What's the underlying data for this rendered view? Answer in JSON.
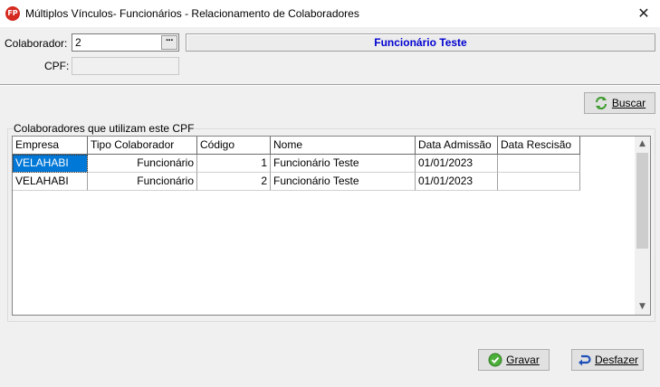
{
  "window": {
    "app_icon_text": "FP",
    "title": "Múltiplos Vínculos- Funcionários - Relacionamento de Colaboradores",
    "close_glyph": "✕"
  },
  "form": {
    "colaborador_label": "Colaborador:",
    "colaborador_value": "2",
    "lookup_button_label": "···",
    "colaborador_name": "Funcionário Teste",
    "cpf_label": "CPF:",
    "cpf_value": ""
  },
  "buscar": {
    "label": "Buscar",
    "icon": "refresh-icon"
  },
  "group": {
    "title": "Colaboradores que utilizam este CPF",
    "columns": [
      "Empresa",
      "Tipo Colaborador",
      "Código",
      "Nome",
      "Data Admissão",
      "Data Rescisão"
    ],
    "rows": [
      {
        "empresa": "VELAHABI",
        "tipo": "Funcionário",
        "codigo": "1",
        "nome": "Funcionário Teste",
        "admissao": "01/01/2023",
        "rescisao": ""
      },
      {
        "empresa": "VELAHABI",
        "tipo": "Funcionário",
        "codigo": "2",
        "nome": "Funcionário Teste",
        "admissao": "01/01/2023",
        "rescisao": ""
      }
    ]
  },
  "footer": {
    "gravar_label": "Gravar",
    "gravar_icon": "check-circle-icon",
    "desfazer_label": "Desfazer",
    "desfazer_icon": "undo-icon"
  },
  "colors": {
    "selection": "#0078d7",
    "name_text": "#0000d0",
    "app_icon": "#d42a20"
  }
}
